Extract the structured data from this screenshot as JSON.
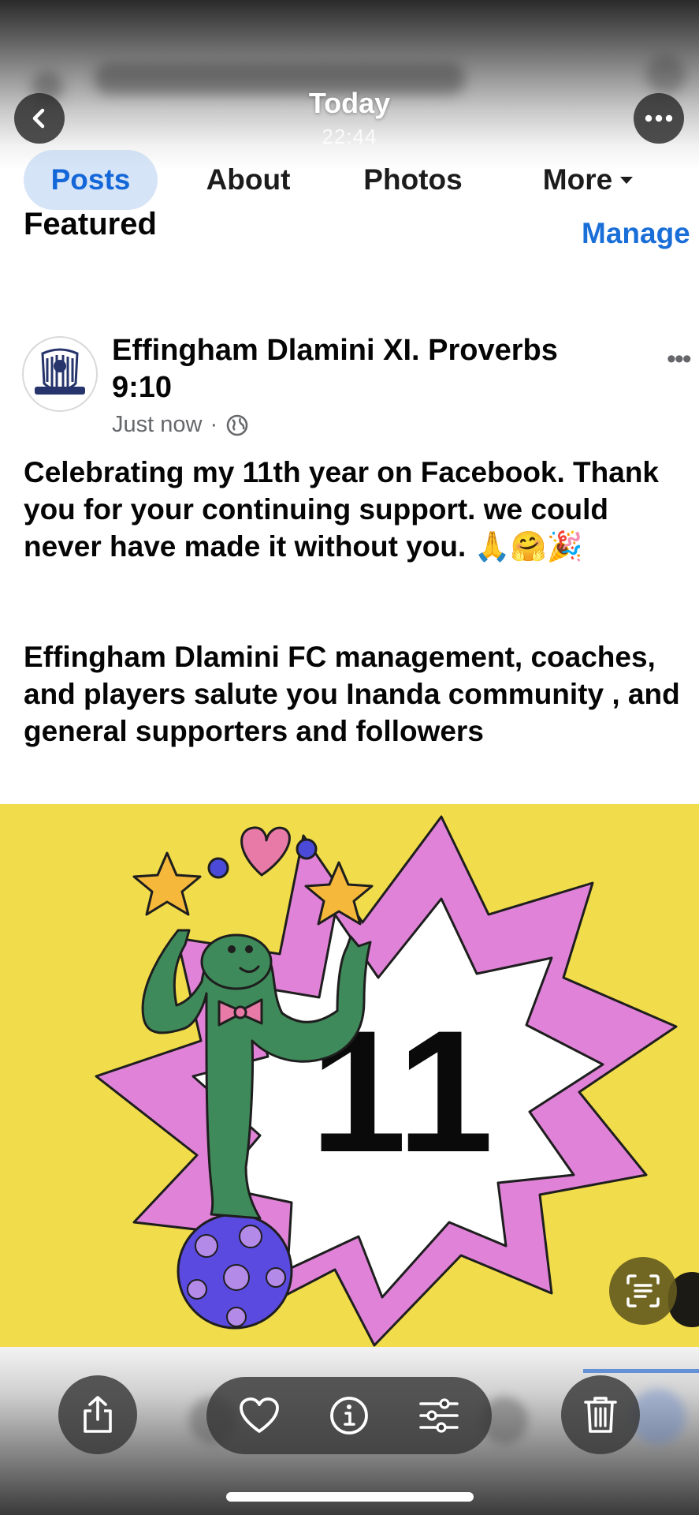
{
  "header": {
    "title": "Today",
    "time": "22:44"
  },
  "tabs": [
    {
      "label": "Posts",
      "active": true
    },
    {
      "label": "About"
    },
    {
      "label": "Photos"
    },
    {
      "label": "More"
    }
  ],
  "featured": {
    "heading": "Featured",
    "manage_label": "Manage"
  },
  "post": {
    "page_name": "Effingham Dlamini XI. Proverbs 9:10",
    "timestamp": "Just now",
    "separator": "·",
    "menu_label": "•••",
    "paragraph1": "Celebrating my 11th year on Facebook. Thank you for your continuing support. we could never have made it without you.",
    "paragraph1_emoji": "🙏🤗🎉",
    "paragraph2": "Effingham Dlamini FC management, coaches, and players salute you Inanda community , and general supporters and followers",
    "image": {
      "number": "11",
      "background_color": "#f1dc4b",
      "starburst_color": "#e083d8"
    }
  },
  "icons": {
    "back": "chevron-left-icon",
    "more": "ellipsis-icon",
    "share": "share-icon",
    "like": "heart-icon",
    "info": "info-icon",
    "adjust": "sliders-icon",
    "delete": "trash-icon",
    "scan": "text-scan-icon"
  },
  "colors": {
    "accent": "#1a6ed8",
    "text": "#050505",
    "secondary_text": "#65676b"
  }
}
